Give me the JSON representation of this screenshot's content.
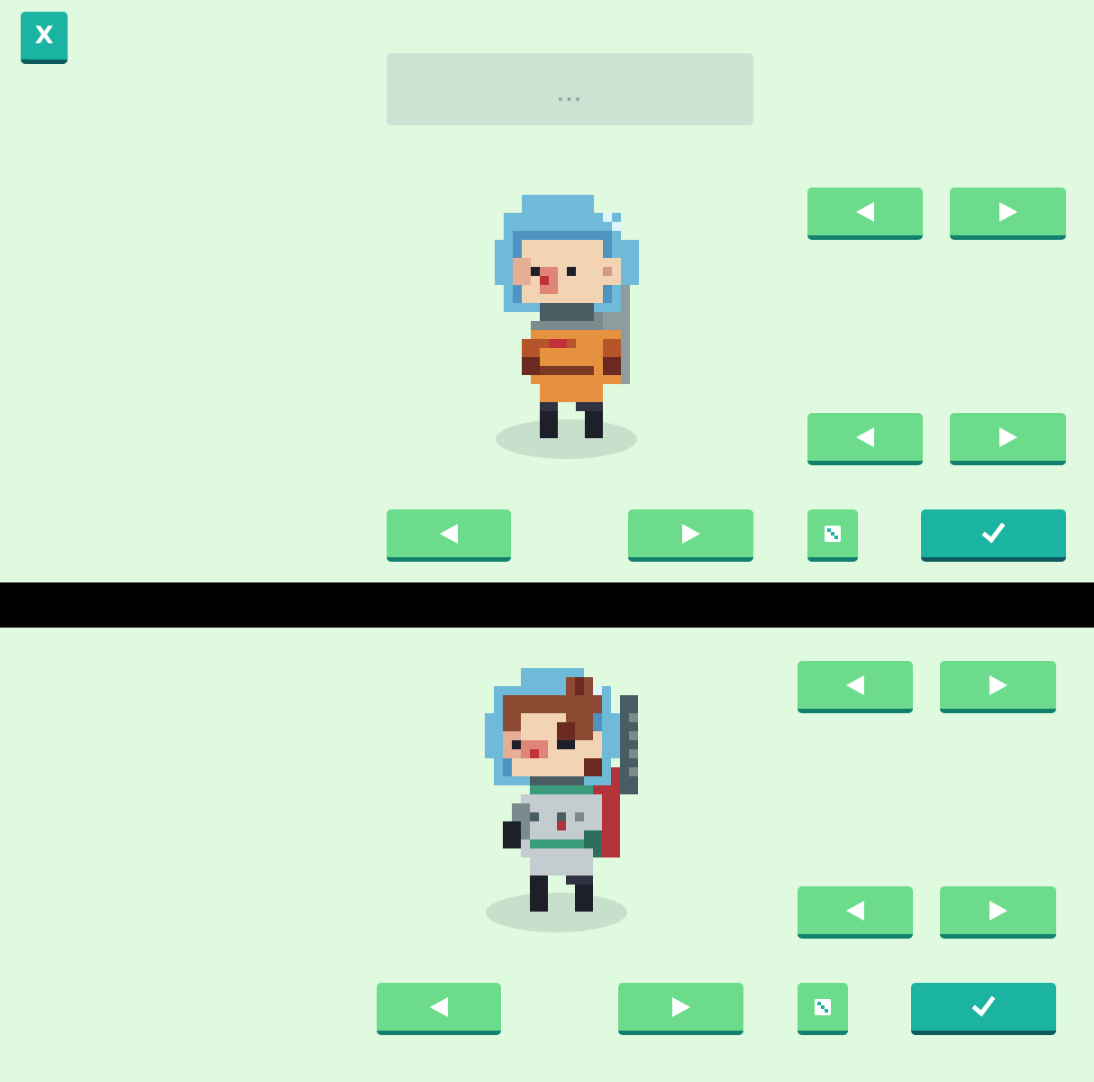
{
  "close_button": {
    "label": "X",
    "icon": "close-icon"
  },
  "speech_bubble": {
    "text": "..."
  },
  "colors": {
    "background": "#e0fae0",
    "button_green": "#6cdc8c",
    "button_green_edge": "#11806c",
    "button_teal": "#1bb3a2",
    "button_teal_edge": "#0f5a5c",
    "divider": "#000000",
    "helmet_blue": "#6fbad8",
    "suit_orange": "#e5913f",
    "suit_grey": "#c5ccd0",
    "suit_green": "#3a9c7d"
  },
  "characters": [
    {
      "name": "astronaut-orange-suit",
      "controls": [
        "prev-row1",
        "next-row1",
        "prev-row2",
        "next-row2",
        "prev-main",
        "next-main",
        "randomize",
        "confirm"
      ]
    },
    {
      "name": "astronaut-grey-suit",
      "controls": [
        "prev-row1",
        "next-row1",
        "prev-row2",
        "next-row2",
        "prev-main",
        "next-main",
        "randomize",
        "confirm"
      ]
    }
  ]
}
